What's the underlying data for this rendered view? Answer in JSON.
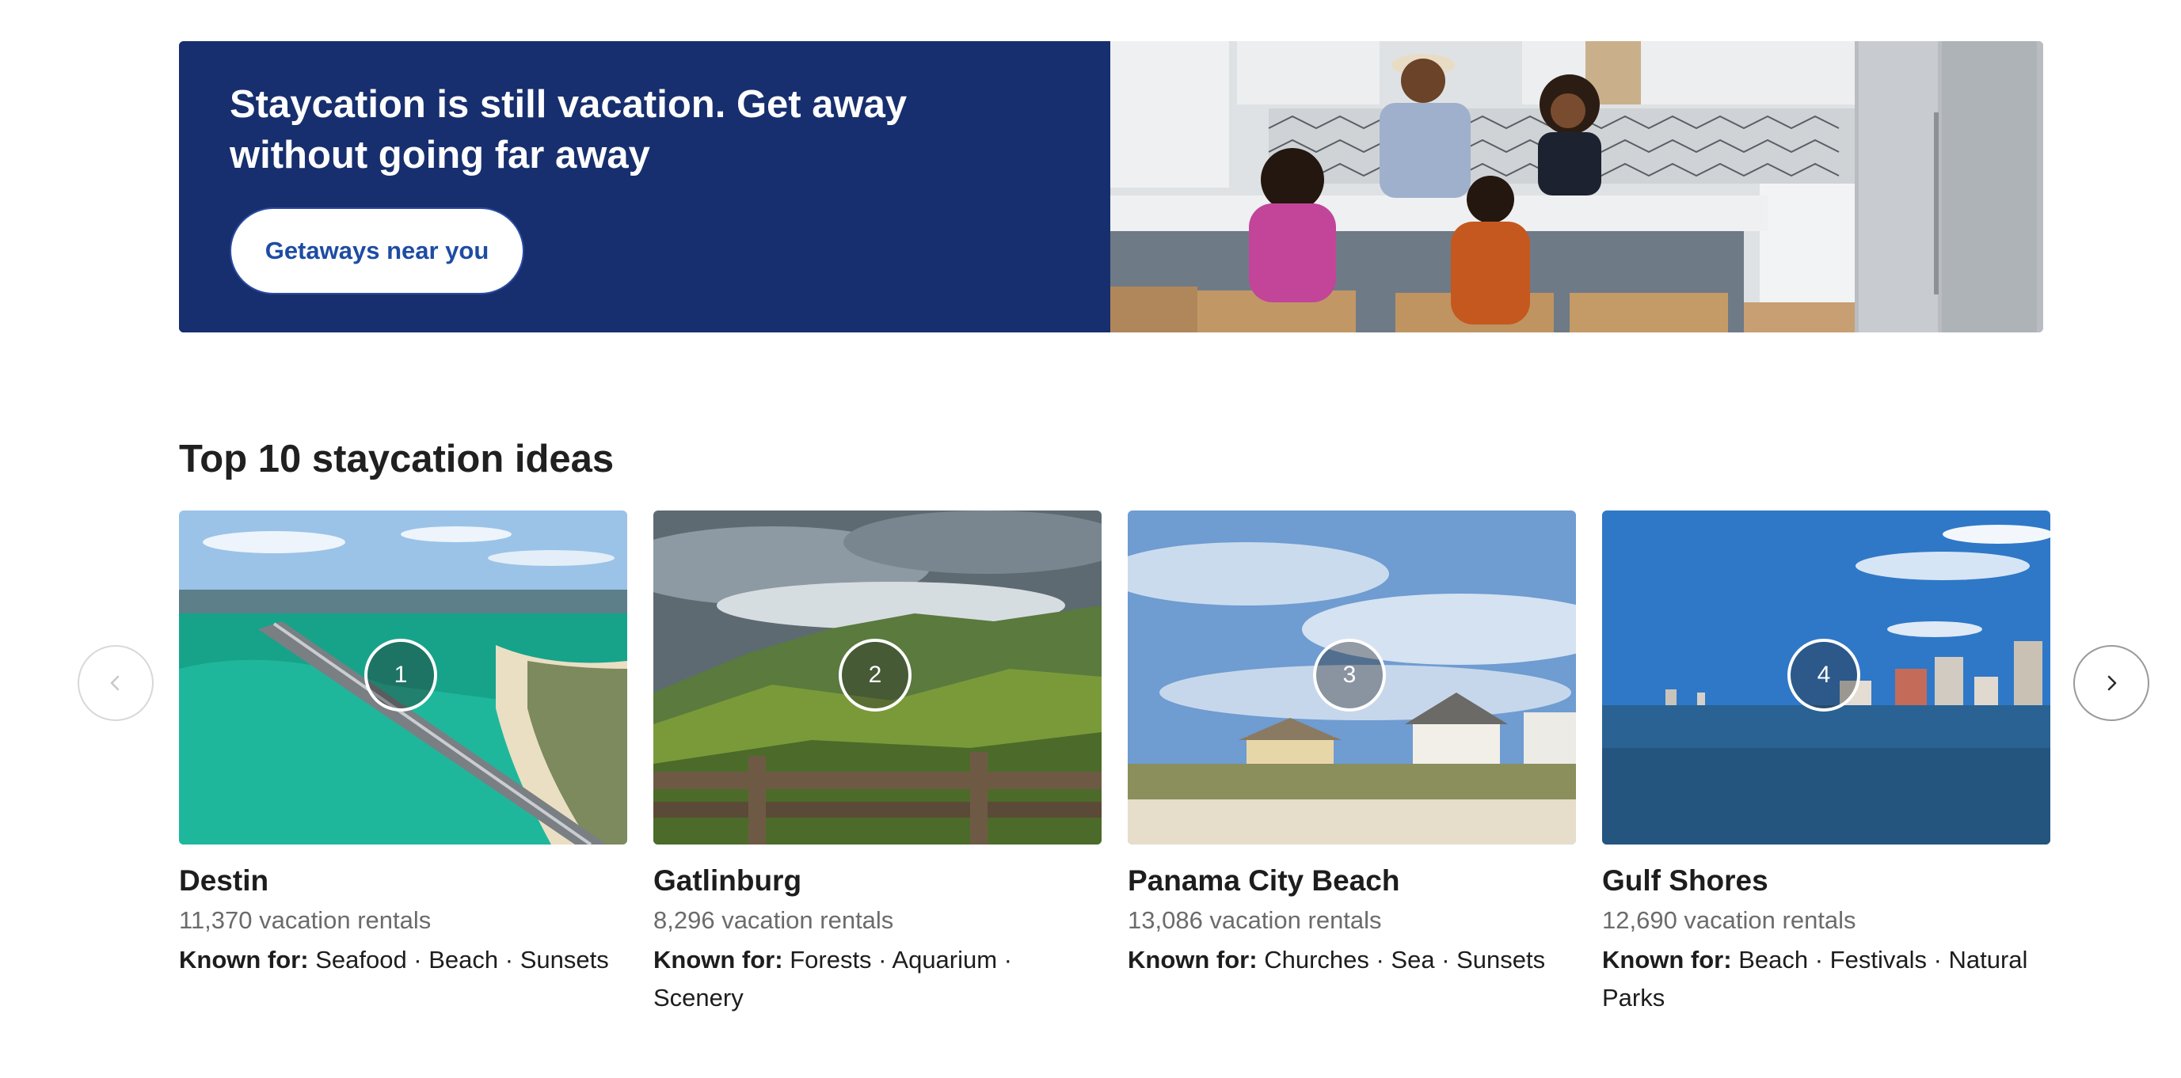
{
  "banner": {
    "title": "Staycation is still vacation. Get away without going far away",
    "button_label": "Getaways near you"
  },
  "section": {
    "title": "Top 10 staycation ideas"
  },
  "cards": [
    {
      "rank": "1",
      "name": "Destin",
      "count": "11,370 vacation rentals",
      "known_label": "Known for:",
      "known_text": "Seafood · Beach · Sunsets"
    },
    {
      "rank": "2",
      "name": "Gatlinburg",
      "count": "8,296 vacation rentals",
      "known_label": "Known for:",
      "known_text": "Forests · Aquarium · Scenery"
    },
    {
      "rank": "3",
      "name": "Panama City Beach",
      "count": "13,086 vacation rentals",
      "known_label": "Known for:",
      "known_text": "Churches · Sea · Sunsets"
    },
    {
      "rank": "4",
      "name": "Gulf Shores",
      "count": "12,690 vacation rentals",
      "known_label": "Known for:",
      "known_text": "Beach · Festivals · Natural Parks"
    }
  ],
  "carousel": {
    "prev_icon": "chevron-left-icon",
    "next_icon": "chevron-right-icon"
  },
  "colors": {
    "banner_bg": "#172f6e",
    "button_text": "#1e4ca3",
    "heading_text": "#202020",
    "muted_text": "#6b6b6b"
  }
}
